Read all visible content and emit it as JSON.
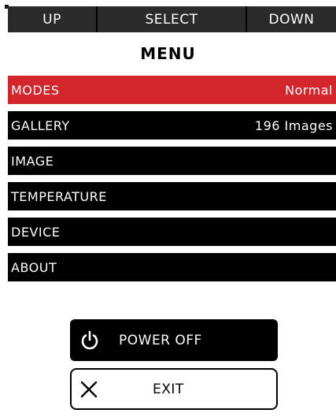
{
  "top_bar": {
    "up_label": "UP",
    "select_label": "SELECT",
    "down_label": "DOWN"
  },
  "menu": {
    "title": "MENU",
    "items": [
      {
        "label": "MODES",
        "value": "Normal",
        "selected": true
      },
      {
        "label": "GALLERY",
        "value": "196 Images",
        "selected": false
      },
      {
        "label": "IMAGE",
        "value": "",
        "selected": false
      },
      {
        "label": "TEMPERATURE",
        "value": "",
        "selected": false
      },
      {
        "label": "DEVICE",
        "value": "",
        "selected": false
      },
      {
        "label": "ABOUT",
        "value": "",
        "selected": false
      }
    ]
  },
  "power_button": {
    "label": "POWER OFF",
    "icon": "power-icon"
  },
  "exit_button": {
    "label": "EXIT",
    "icon": "close-icon"
  },
  "colors": {
    "selected_bg": "#d3262c",
    "item_bg": "#000000",
    "topbar_bg": "#2a2a2a"
  }
}
